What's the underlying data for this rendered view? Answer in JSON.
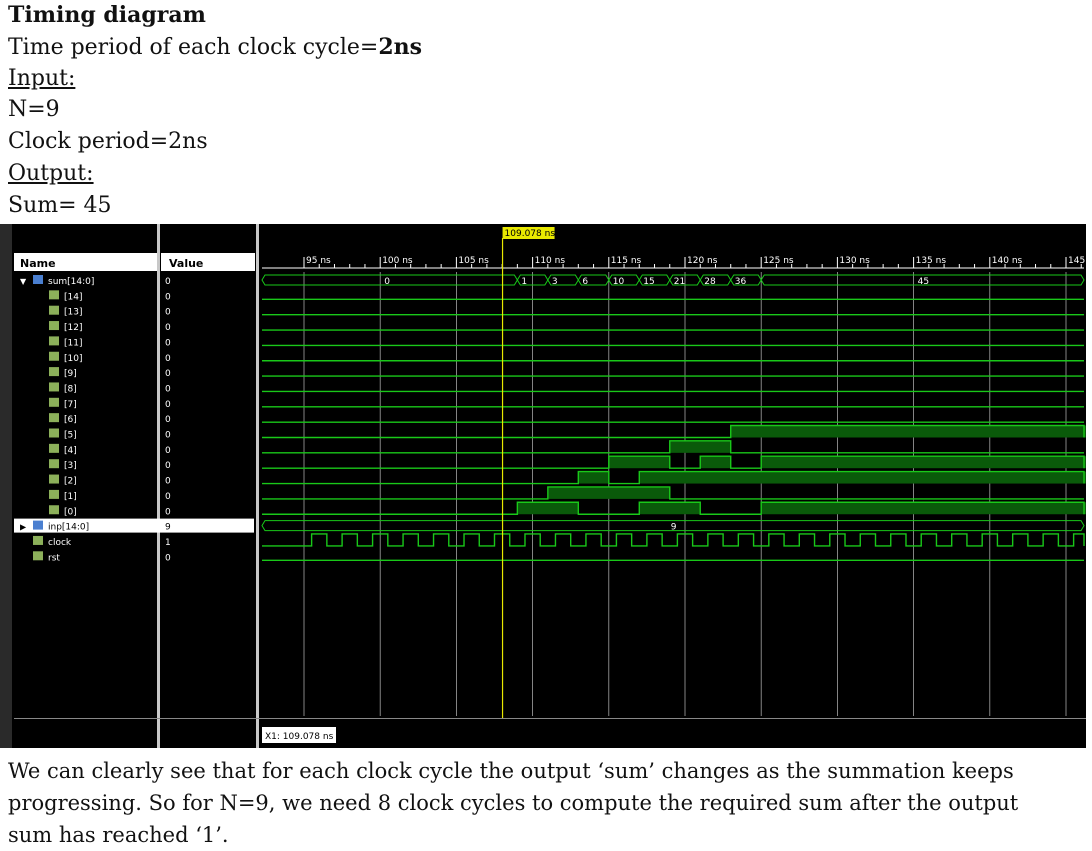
{
  "header": {
    "title": "Timing diagram",
    "period_prefix": "Time period of each clock cycle=",
    "period_value": "2ns",
    "input_heading": "Input:",
    "input_n": "N=9",
    "input_clock": "Clock period=2ns",
    "output_heading": "Output:",
    "output_sum": "Sum= 45"
  },
  "simulator": {
    "cursor_label": "109.078 ns",
    "cursor_readout": "X1: 109.078 ns",
    "name_header": "Name",
    "value_header": "Value",
    "signals": [
      {
        "name": "sum[14:0]",
        "value": "0",
        "kind": "bus"
      },
      {
        "name": "[14]",
        "value": "0",
        "kind": "bit"
      },
      {
        "name": "[13]",
        "value": "0",
        "kind": "bit"
      },
      {
        "name": "[12]",
        "value": "0",
        "kind": "bit"
      },
      {
        "name": "[11]",
        "value": "0",
        "kind": "bit"
      },
      {
        "name": "[10]",
        "value": "0",
        "kind": "bit"
      },
      {
        "name": "[9]",
        "value": "0",
        "kind": "bit"
      },
      {
        "name": "[8]",
        "value": "0",
        "kind": "bit"
      },
      {
        "name": "[7]",
        "value": "0",
        "kind": "bit"
      },
      {
        "name": "[6]",
        "value": "0",
        "kind": "bit"
      },
      {
        "name": "[5]",
        "value": "0",
        "kind": "bit"
      },
      {
        "name": "[4]",
        "value": "0",
        "kind": "bit"
      },
      {
        "name": "[3]",
        "value": "0",
        "kind": "bit"
      },
      {
        "name": "[2]",
        "value": "0",
        "kind": "bit"
      },
      {
        "name": "[1]",
        "value": "0",
        "kind": "bit"
      },
      {
        "name": "[0]",
        "value": "0",
        "kind": "bit"
      },
      {
        "name": "inp[14:0]",
        "value": "9",
        "kind": "bus"
      },
      {
        "name": "clock",
        "value": "1",
        "kind": "bit"
      },
      {
        "name": "rst",
        "value": "0",
        "kind": "bit"
      }
    ],
    "time_ticks": [
      "95 ns",
      "100 ns",
      "105 ns",
      "110 ns",
      "115 ns",
      "120 ns",
      "125 ns",
      "130 ns",
      "135 ns",
      "140 ns",
      "145"
    ],
    "sum_values": [
      "0",
      "1",
      "3",
      "6",
      "10",
      "15",
      "21",
      "28",
      "36",
      "45"
    ],
    "inp_value": "9",
    "colors": {
      "wave": "#19c819",
      "fill": "#0a5a0a",
      "cursor": "#e8e800",
      "grid": "#dcdcdc",
      "bg": "#000000"
    }
  },
  "paragraph": "We can clearly see that for each clock cycle the output ‘sum’ changes as the summation keeps progressing. So for N=9, we need 8 clock cycles to compute the required sum after the output sum has reached ‘1’."
}
